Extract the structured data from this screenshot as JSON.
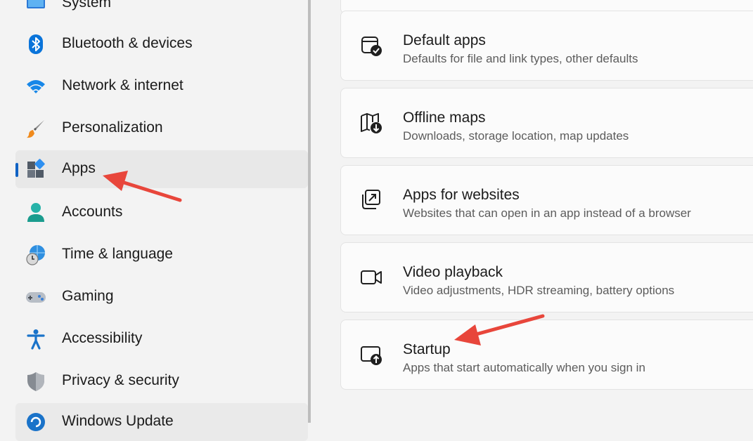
{
  "sidebar": {
    "items": [
      {
        "label": "System",
        "icon": "system-icon"
      },
      {
        "label": "Bluetooth & devices",
        "icon": "bluetooth-icon"
      },
      {
        "label": "Network & internet",
        "icon": "wifi-icon"
      },
      {
        "label": "Personalization",
        "icon": "paintbrush-icon"
      },
      {
        "label": "Apps",
        "icon": "apps-icon",
        "selected": true
      },
      {
        "label": "Accounts",
        "icon": "person-icon"
      },
      {
        "label": "Time & language",
        "icon": "globe-clock-icon"
      },
      {
        "label": "Gaming",
        "icon": "gamepad-icon"
      },
      {
        "label": "Accessibility",
        "icon": "accessibility-icon"
      },
      {
        "label": "Privacy & security",
        "icon": "shield-icon"
      },
      {
        "label": "Windows Update",
        "icon": "update-icon"
      }
    ]
  },
  "main": {
    "cards": [
      {
        "title": "Default apps",
        "subtitle": "Defaults for file and link types, other defaults",
        "icon": "default-apps-icon"
      },
      {
        "title": "Offline maps",
        "subtitle": "Downloads, storage location, map updates",
        "icon": "map-download-icon"
      },
      {
        "title": "Apps for websites",
        "subtitle": "Websites that can open in an app instead of a browser",
        "icon": "open-external-icon"
      },
      {
        "title": "Video playback",
        "subtitle": "Video adjustments, HDR streaming, battery options",
        "icon": "video-camera-icon"
      },
      {
        "title": "Startup",
        "subtitle": "Apps that start automatically when you sign in",
        "icon": "startup-icon"
      }
    ]
  },
  "colors": {
    "accent": "#1062c4",
    "annotation_arrow": "#e8463b"
  }
}
